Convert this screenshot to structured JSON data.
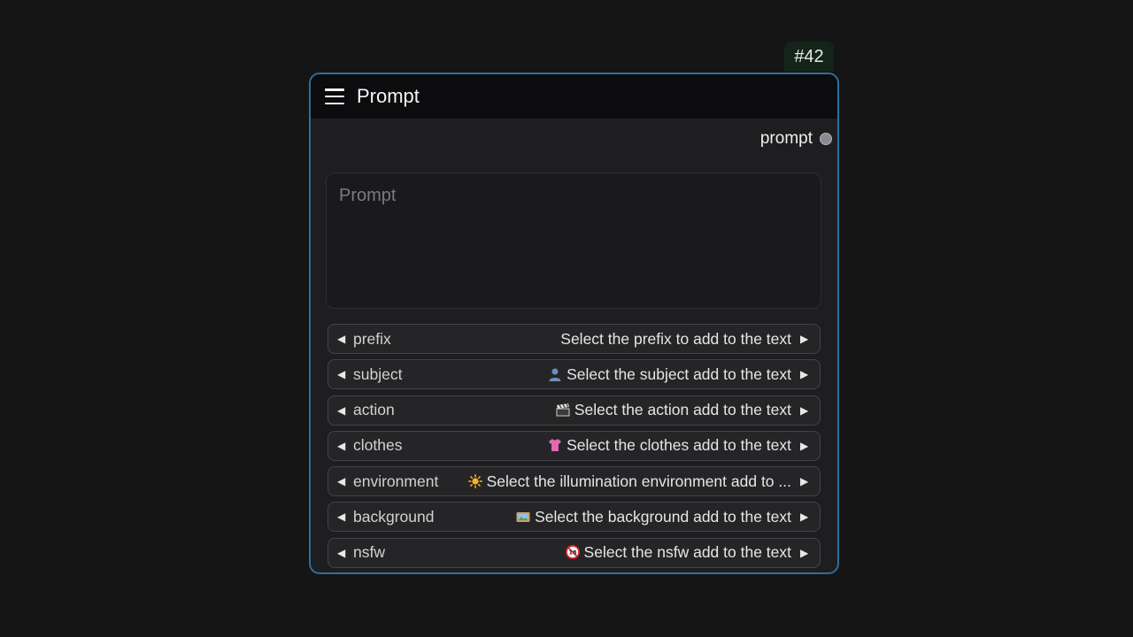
{
  "node": {
    "id_badge": "#42",
    "title": "Prompt",
    "output_label": "prompt",
    "prompt_placeholder": "Prompt",
    "prompt_value": ""
  },
  "combos": [
    {
      "label": "prefix",
      "value": "Select the prefix to add to the text",
      "icon": ""
    },
    {
      "label": "subject",
      "value": "Select the subject add to the text",
      "icon": "person-icon"
    },
    {
      "label": "action",
      "value": "Select the action add to the text",
      "icon": "clapperboard-icon"
    },
    {
      "label": "clothes",
      "value": "Select the clothes add to the text",
      "icon": "tshirt-icon"
    },
    {
      "label": "environment",
      "value": "Select the illumination environment add to ...",
      "icon": "sun-icon"
    },
    {
      "label": "background",
      "value": "Select the background add to the text",
      "icon": "framed-picture-icon"
    },
    {
      "label": "nsfw",
      "value": "Select the nsfw add to the text",
      "icon": "no-under-18-icon"
    }
  ],
  "colors": {
    "background": "#151515",
    "node_border": "#2e6e9e",
    "badge_bg": "#14241a"
  }
}
